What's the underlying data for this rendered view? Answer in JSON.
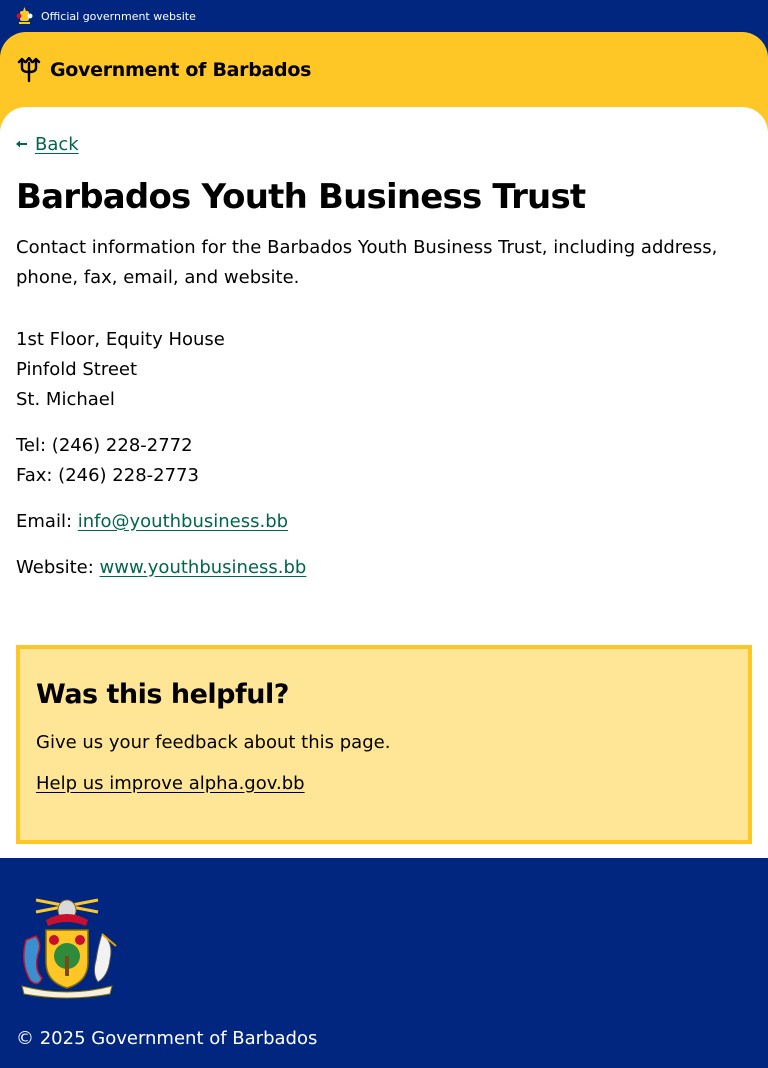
{
  "topbar": {
    "official_text": "Official government website"
  },
  "header": {
    "brand": "Government of Barbados"
  },
  "nav": {
    "back_label": "Back"
  },
  "page": {
    "title": "Barbados Youth Business Trust",
    "lead": "Contact information for the Barbados Youth Business Trust, including address, phone, fax, email, and website."
  },
  "contact": {
    "address_lines": [
      "1st Floor, Equity House",
      "Pinfold Street",
      "St. Michael"
    ],
    "tel": "Tel: (246) 228-2772",
    "fax": "Fax: (246) 228-2773",
    "email_label": "Email: ",
    "email": "info@youthbusiness.bb",
    "website_label": "Website: ",
    "website": "www.youthbusiness.bb"
  },
  "feedback": {
    "title": "Was this helpful?",
    "text": "Give us your feedback about this page.",
    "link": "Help us improve alpha.gov.bb"
  },
  "footer": {
    "copyright": "© 2025 Government of Barbados"
  },
  "colors": {
    "navy": "#00267f",
    "gold": "#ffc726",
    "link_green": "#00654a",
    "feedback_bg": "#ffe696"
  }
}
